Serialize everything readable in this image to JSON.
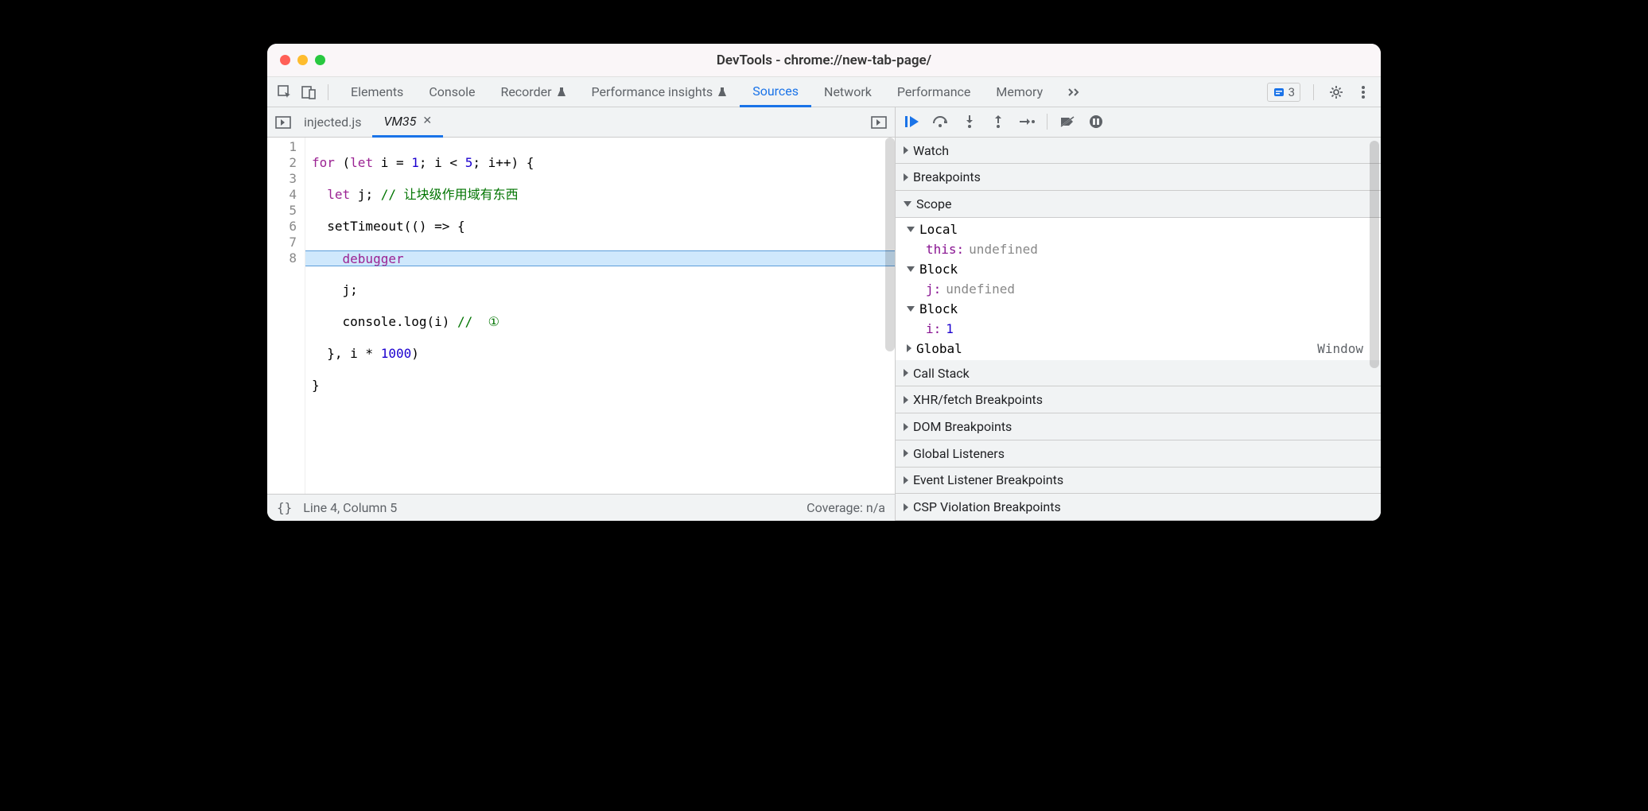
{
  "window": {
    "title": "DevTools - chrome://new-tab-page/"
  },
  "toolbar": {
    "tabs": [
      "Elements",
      "Console",
      "Recorder",
      "Performance insights",
      "Sources",
      "Network",
      "Performance",
      "Memory"
    ],
    "active_tab": "Sources",
    "issues_count": "3"
  },
  "file_tabs": {
    "items": [
      "injected.js",
      "VM35"
    ],
    "active": "VM35"
  },
  "code": {
    "lines": [
      "1",
      "2",
      "3",
      "4",
      "5",
      "6",
      "7",
      "8"
    ],
    "highlighted_line": 4,
    "tokens": {
      "l1_for": "for",
      "l1_let": "let",
      "l1_i": " i = ",
      "l1_one": "1",
      "l1_semi": "; i < ",
      "l1_five": "5",
      "l1_inc": "; i++) {",
      "l2_let": "let",
      "l2_j": " j; ",
      "l2_cmt": "// 让块级作用域有东西",
      "l3": "  setTimeout(() => {",
      "l4_dbg": "debugger",
      "l5": "    j;",
      "l6_a": "    console.log(i) ",
      "l6_cmt": "//  ①",
      "l7_a": "  }, i * ",
      "l7_n": "1000",
      "l7_b": ")",
      "l8": "}"
    }
  },
  "statusbar": {
    "braces": "{}",
    "position": "Line 4, Column 5",
    "coverage": "Coverage: n/a"
  },
  "debug_sections": {
    "watch": "Watch",
    "breakpoints": "Breakpoints",
    "scope": "Scope",
    "call_stack": "Call Stack",
    "xhr": "XHR/fetch Breakpoints",
    "dom": "DOM Breakpoints",
    "global_listeners": "Global Listeners",
    "event_listener": "Event Listener Breakpoints",
    "csp": "CSP Violation Breakpoints"
  },
  "scope": {
    "local_label": "Local",
    "local_this_k": "this",
    "local_this_v": "undefined",
    "block1_label": "Block",
    "block1_k": "j",
    "block1_v": "undefined",
    "block2_label": "Block",
    "block2_k": "i",
    "block2_v": "1",
    "global_label": "Global",
    "global_v": "Window",
    "colon": ": "
  }
}
